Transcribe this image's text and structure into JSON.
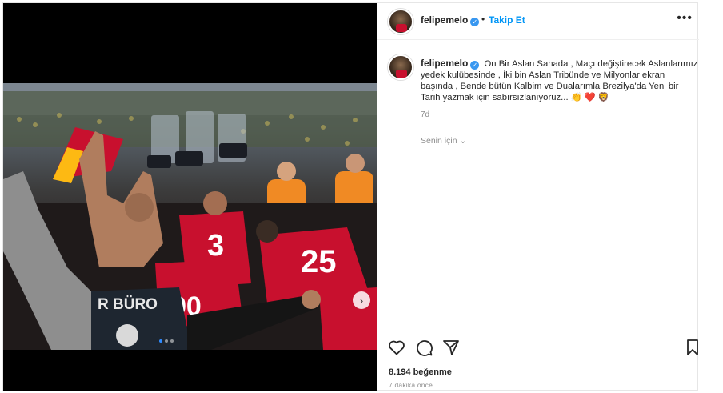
{
  "post": {
    "username": "felipemelo",
    "verified": true,
    "follow_label": "Takip Et",
    "separator": "•",
    "more_label": "•••",
    "caption": "On Bir Aslan Sahada , Maçı değiştirecek Aslanlarımız yedek kulübesinde , İki bin Aslan Tribünde ve Milyonlar ekran başında , Bende bütün Kalbim ve Dualarımla Brezilya'da Yeni bir Tarih yazmak için sabırsızlanıyoruz...",
    "caption_emojis": [
      "👏",
      "❤️",
      "🦁"
    ],
    "age": "7d",
    "translation_label": "Senin için",
    "likes": "8.194 beğenme",
    "time_ago": "7 dakika önce"
  },
  "media": {
    "carousel_count": 3,
    "carousel_active": 0,
    "next_arrow": "›",
    "jersey_numbers": [
      "3",
      "90",
      "25"
    ],
    "vest_text": "R BÜRO"
  },
  "icons": {
    "like": "heart-icon",
    "comment": "comment-icon",
    "share": "paper-plane-icon",
    "save": "bookmark-icon",
    "verified": "verified-badge-icon",
    "more": "more-options-icon"
  },
  "colors": {
    "accent": "#0095f6",
    "verified": "#3897f0",
    "jersey_red": "#c8102e",
    "jersey_yellow": "#fdb913"
  }
}
